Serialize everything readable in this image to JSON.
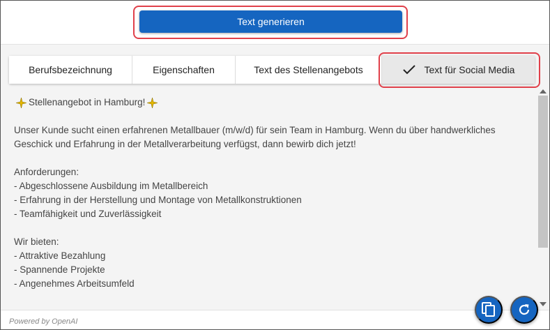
{
  "header": {
    "generate_button_label": "Text generieren"
  },
  "tabs": [
    {
      "label": "Berufsbezeichnung",
      "active": false
    },
    {
      "label": "Eigenschaften",
      "active": false
    },
    {
      "label": "Text des Stellenangebots",
      "active": false
    },
    {
      "label": "Text für Social Media",
      "active": true
    }
  ],
  "content": {
    "headline": "Stellenangebot in Hamburg!",
    "intro_line1": "Unser Kunde sucht einen erfahrenen Metallbauer (m/w/d) für sein Team in Hamburg. Wenn du über handwerkliches",
    "intro_line2": "Geschick und Erfahrung in der Metallverarbeitung verfügst, dann bewirb dich jetzt!",
    "requirements_title": "Anforderungen:",
    "requirements": [
      "- Abgeschlossene Ausbildung im Metallbereich",
      "- Erfahrung in der Herstellung und Montage von Metallkonstruktionen",
      "- Teamfähigkeit und Zuverlässigkeit"
    ],
    "offers_title": "Wir bieten:",
    "offers": [
      "- Attraktive Bezahlung",
      "- Spannende Projekte",
      "- Angenehmes Arbeitsumfeld"
    ]
  },
  "footer": {
    "powered_by": "Powered by OpenAI"
  },
  "icons": {
    "headline_decoration": "sparkle-icon",
    "active_tab": "check-icon",
    "copy_button": "copy-icon",
    "refresh_button": "refresh-icon"
  },
  "colors": {
    "accent": "#1565c0",
    "highlight": "#e0404a"
  }
}
